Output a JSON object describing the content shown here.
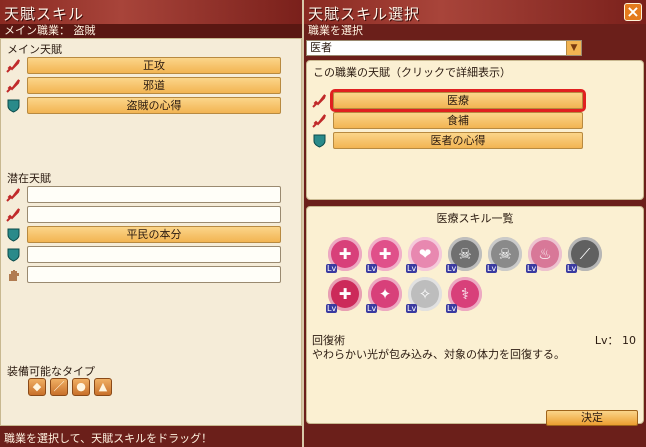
{
  "left_window": {
    "title": "天賦スキル",
    "job_line": "メイン職業：  盗賊",
    "main_label": "メイン天賦",
    "main_slots": [
      {
        "icon": "sword-icon",
        "label": "正攻",
        "filled": true
      },
      {
        "icon": "sword-icon",
        "label": "邪道",
        "filled": true
      },
      {
        "icon": "shield-icon",
        "label": "盗賊の心得",
        "filled": true
      }
    ],
    "latent_label": "潜在天賦",
    "latent_slots": [
      {
        "icon": "sword-icon",
        "label": "",
        "filled": false
      },
      {
        "icon": "sword-icon",
        "label": "",
        "filled": false
      },
      {
        "icon": "shield-icon",
        "label": "平民の本分",
        "filled": true
      },
      {
        "icon": "shield-icon",
        "label": "",
        "filled": false
      },
      {
        "icon": "hand-icon",
        "label": "",
        "filled": false
      }
    ],
    "equip_label": "装備可能なタイプ",
    "equip_types": [
      "head-armor-icon",
      "dagger-icon",
      "bowl-icon",
      "robe-icon"
    ],
    "footer": "職業を選択して、天賦スキルをドラッグ！"
  },
  "right_window": {
    "title": "天賦スキル選択",
    "select_label": "職業を選択",
    "selected_job": "医者",
    "talent_title": "この職業の天賦（クリックで詳細表示）",
    "talents": [
      {
        "icon": "sword-icon",
        "label": "医療",
        "selected": true
      },
      {
        "icon": "sword-icon",
        "label": "食補",
        "selected": false
      },
      {
        "icon": "shield-icon",
        "label": "医者の心得",
        "selected": false
      }
    ],
    "skill_list_title": "医療スキル一覧",
    "skills": [
      {
        "icon": "medical-syringe-icon",
        "color": "#d8407a"
      },
      {
        "icon": "medical-cross-icon",
        "color": "#e0508a"
      },
      {
        "icon": "heart-heal-icon",
        "color": "#e888b0"
      },
      {
        "icon": "skull-icon",
        "color": "#707070"
      },
      {
        "icon": "skull-icon",
        "color": "#8a8a8a"
      },
      {
        "icon": "flask-icon",
        "color": "#d87898"
      },
      {
        "icon": "needle-icon",
        "color": "#606060"
      },
      {
        "icon": "recovery-cross-icon",
        "color": "#cc2a5a"
      },
      {
        "icon": "angel-icon",
        "color": "#d8407a"
      },
      {
        "icon": "silver-wing-icon",
        "color": "#bdbdbd"
      },
      {
        "icon": "caduceus-icon",
        "color": "#d8407a"
      }
    ],
    "skill_name": "回復術",
    "skill_level": "Lv： 10",
    "skill_desc": "やわらかい光が包み込み、対象の体力を回復する。",
    "confirm_label": "決定"
  }
}
